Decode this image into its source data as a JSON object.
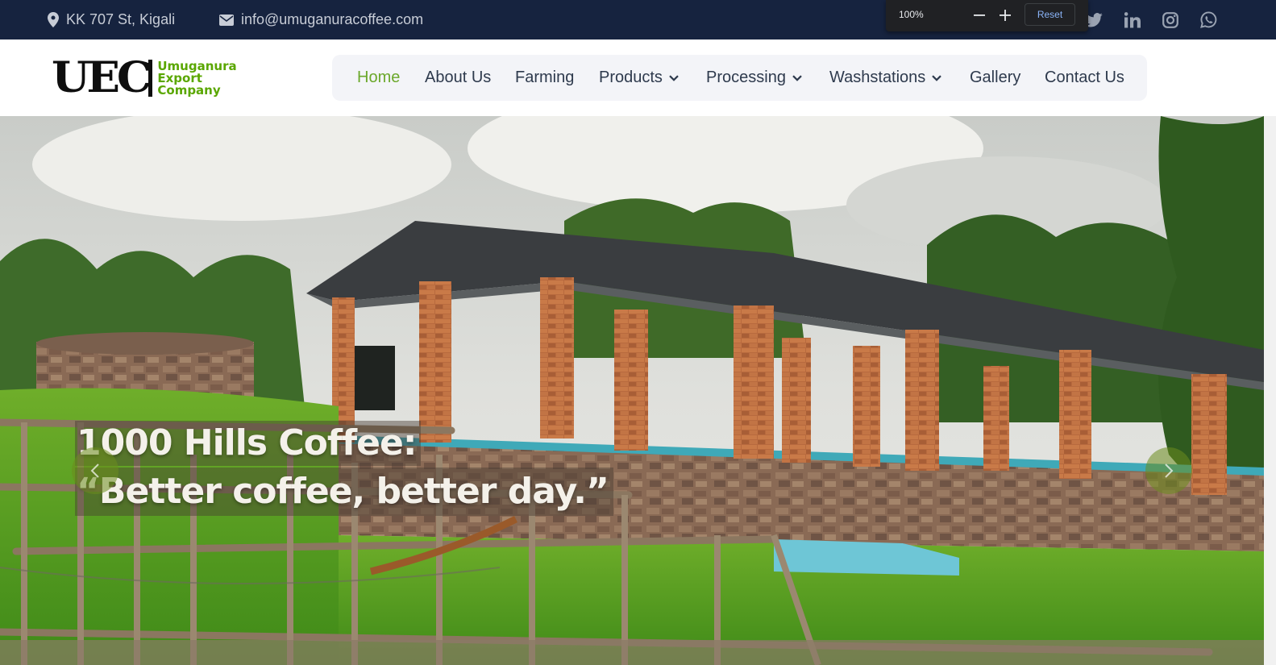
{
  "topbar": {
    "address": "KK 707 St, Kigali",
    "email": "info@umuganuracoffee.com",
    "social_icons": [
      "twitter-icon",
      "linkedin-icon",
      "instagram-icon",
      "whatsapp-icon"
    ]
  },
  "zoom_popup": {
    "level": "100%",
    "reset_label": "Reset"
  },
  "logo": {
    "mark": "UEC",
    "words": [
      "Umuganura",
      "Export",
      "Company"
    ]
  },
  "nav": {
    "items": [
      {
        "label": "Home",
        "active": true,
        "dropdown": false
      },
      {
        "label": "About Us",
        "active": false,
        "dropdown": false
      },
      {
        "label": "Farming",
        "active": false,
        "dropdown": false
      },
      {
        "label": "Products",
        "active": false,
        "dropdown": true
      },
      {
        "label": "Processing",
        "active": false,
        "dropdown": true
      },
      {
        "label": "Washstations",
        "active": false,
        "dropdown": true
      },
      {
        "label": "Gallery",
        "active": false,
        "dropdown": false
      },
      {
        "label": "Contact Us",
        "active": false,
        "dropdown": false
      }
    ]
  },
  "hero": {
    "line1": "1000 Hills Coffee:",
    "line2": "“Better coffee, better day.”"
  },
  "colors": {
    "topbar_bg": "#16233f",
    "accent_green": "#6ba82b",
    "nav_text": "#2e3a4d",
    "nav_bg": "#f3f4f8"
  }
}
